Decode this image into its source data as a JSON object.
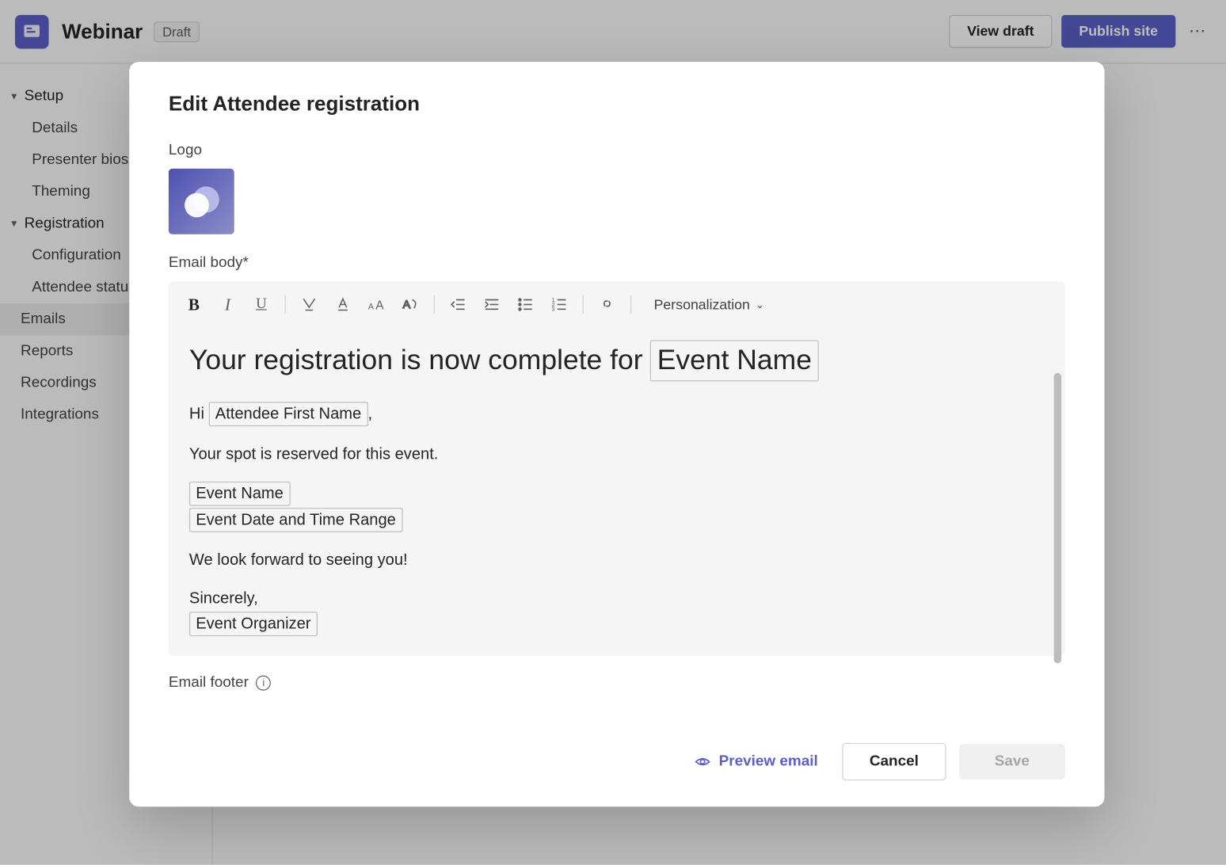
{
  "header": {
    "title": "Webinar",
    "badge": "Draft",
    "view_draft": "View draft",
    "publish": "Publish site"
  },
  "sidebar": {
    "groups": [
      {
        "label": "Setup",
        "items": [
          "Details",
          "Presenter bios",
          "Theming"
        ]
      },
      {
        "label": "Registration",
        "items": [
          "Configuration",
          "Attendee status"
        ]
      }
    ],
    "top_items": [
      "Emails",
      "Reports",
      "Recordings",
      "Integrations"
    ],
    "active": "Emails"
  },
  "modal": {
    "title": "Edit Attendee registration",
    "logo_label": "Logo",
    "body_label": "Email body*",
    "footer_label": "Email footer",
    "toolbar": {
      "personalization": "Personalization"
    },
    "email": {
      "headline_prefix": "Your registration is now complete for ",
      "headline_token": "Event Name",
      "greeting_prefix": "Hi ",
      "greeting_token": "Attendee First Name",
      "greeting_suffix": ",",
      "line1": "Your spot is reserved for this event.",
      "token_event_name": "Event Name",
      "token_event_datetime": "Event Date and Time Range",
      "line2": "We look forward to seeing you!",
      "signoff": "Sincerely,",
      "signoff_token": "Event Organizer"
    },
    "actions": {
      "preview": "Preview email",
      "cancel": "Cancel",
      "save": "Save"
    }
  }
}
